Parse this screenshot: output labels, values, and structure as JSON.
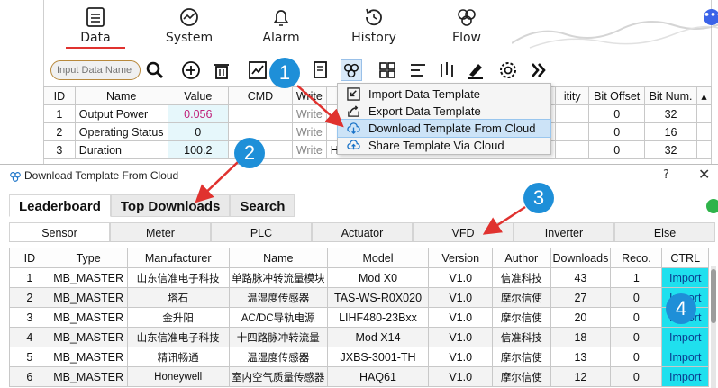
{
  "nav": {
    "tabs": [
      {
        "label": "Data",
        "icon": "list-icon"
      },
      {
        "label": "System",
        "icon": "gauge-icon"
      },
      {
        "label": "Alarm",
        "icon": "bell-icon"
      },
      {
        "label": "History",
        "icon": "history-icon"
      },
      {
        "label": "Flow",
        "icon": "flow-icon"
      }
    ],
    "more_label": "•••"
  },
  "toolbar": {
    "search_placeholder": "Input Data Name"
  },
  "bg_table": {
    "headers": [
      "ID",
      "Name",
      "Value",
      "CMD",
      "Write",
      "U",
      "",
      "",
      "",
      "itity",
      "Bit Offset",
      "Bit Num."
    ],
    "rows": [
      [
        "1",
        "Output Power",
        "0.056",
        "",
        "Write",
        "",
        "0",
        "32"
      ],
      [
        "2",
        "Operating Status",
        "0",
        "",
        "Write",
        "",
        "0",
        "16"
      ],
      [
        "3",
        "Duration",
        "100.2",
        "",
        "Write",
        "Hour",
        "0",
        "32"
      ]
    ]
  },
  "context_menu": {
    "items": [
      "Import Data Template",
      "Export Data Template",
      "Download Template From Cloud",
      "Share Template Via Cloud"
    ]
  },
  "dialog": {
    "title": "Download Template From Cloud",
    "help": "?",
    "close": "✕",
    "top_tabs": [
      "Leaderboard",
      "Top Downloads",
      "Search"
    ],
    "categories": [
      "Sensor",
      "Meter",
      "PLC",
      "Actuator",
      "VFD",
      "Inverter",
      "Else"
    ],
    "columns": [
      "ID",
      "Type",
      "Manufacturer",
      "Name",
      "Model",
      "Version",
      "Author",
      "Downloads",
      "Reco.",
      "CTRL"
    ],
    "rows": [
      {
        "id": "1",
        "type": "MB_MASTER",
        "manufacturer": "山东信准电子科技",
        "name": "单路脉冲转流量模块",
        "model": "Mod X0",
        "version": "V1.0",
        "author": "信准科技",
        "downloads": "43",
        "reco": "1",
        "ctrl": "Import"
      },
      {
        "id": "2",
        "type": "MB_MASTER",
        "manufacturer": "塔石",
        "name": "温湿度传感器",
        "model": "TAS-WS-R0X020",
        "version": "V1.0",
        "author": "摩尔信使",
        "downloads": "27",
        "reco": "0",
        "ctrl": "Import"
      },
      {
        "id": "3",
        "type": "MB_MASTER",
        "manufacturer": "金升阳",
        "name": "AC/DC导轨电源",
        "model": "LIHF480-23Bxx",
        "version": "V1.0",
        "author": "摩尔信使",
        "downloads": "20",
        "reco": "0",
        "ctrl": "Import"
      },
      {
        "id": "4",
        "type": "MB_MASTER",
        "manufacturer": "山东信准电子科技",
        "name": "十四路脉冲转流量",
        "model": "Mod X14",
        "version": "V1.0",
        "author": "信准科技",
        "downloads": "18",
        "reco": "0",
        "ctrl": "Import"
      },
      {
        "id": "5",
        "type": "MB_MASTER",
        "manufacturer": "精讯畅通",
        "name": "温湿度传感器",
        "model": "JXBS-3001-TH",
        "version": "V1.0",
        "author": "摩尔信使",
        "downloads": "13",
        "reco": "0",
        "ctrl": "Import"
      },
      {
        "id": "6",
        "type": "MB_MASTER",
        "manufacturer": "Honeywell",
        "name": "室内空气质量传感器",
        "model": "HAQ61",
        "version": "V1.0",
        "author": "摩尔信使",
        "downloads": "12",
        "reco": "0",
        "ctrl": "Import"
      }
    ]
  },
  "callouts": [
    "1",
    "2",
    "3",
    "4"
  ],
  "colors": {
    "callout": "#1e8fd8",
    "arrow": "#e0322f",
    "import_cell": "#1fe0ee",
    "menu_highlight": "#cce3f7",
    "status_dot": "#2fb34a"
  }
}
